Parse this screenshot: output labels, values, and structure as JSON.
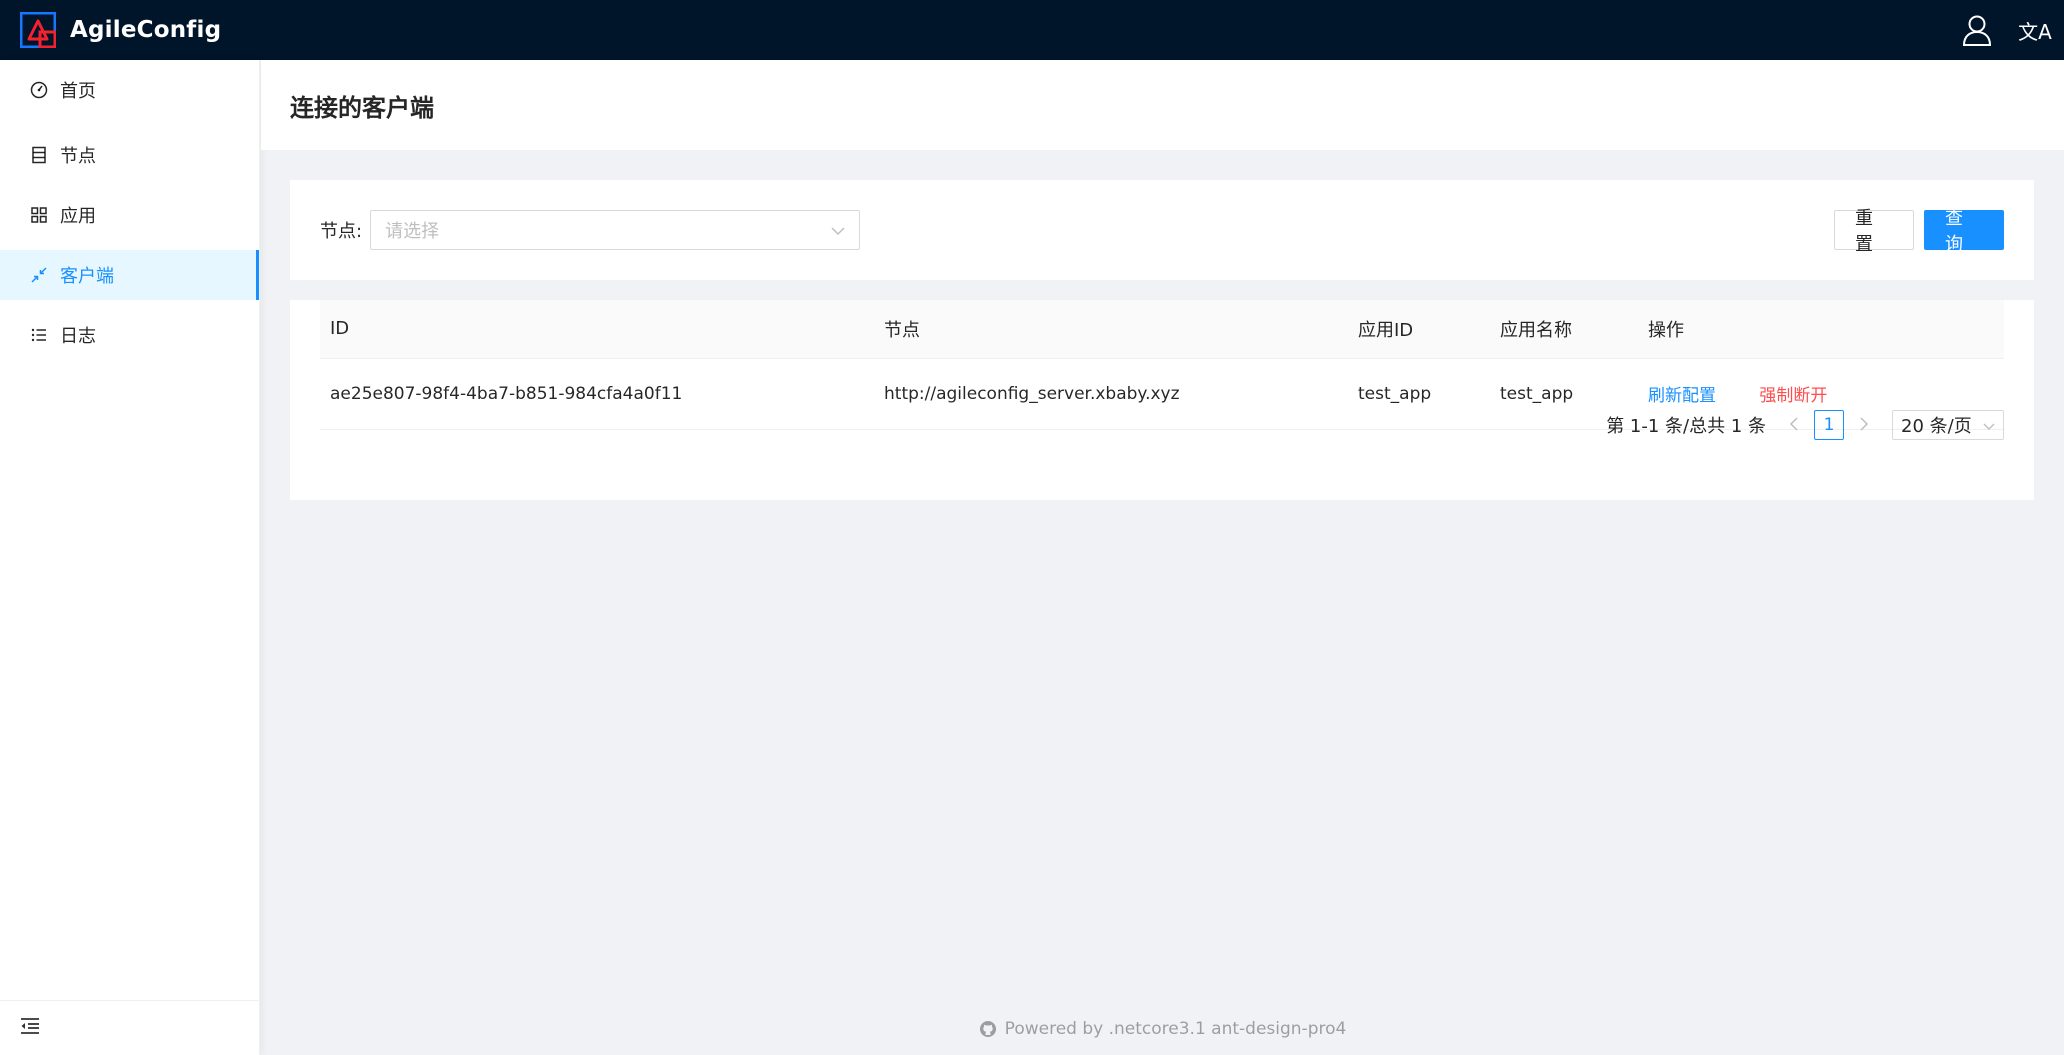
{
  "app": {
    "title": "AgileConfig"
  },
  "header": {
    "user_icon": "user-icon",
    "lang_icon": "translation-icon",
    "lang_glyph": "文A"
  },
  "sidebar": {
    "items": [
      {
        "label": "首页",
        "icon": "dashboard-icon",
        "active": false
      },
      {
        "label": "节点",
        "icon": "database-icon",
        "active": false
      },
      {
        "label": "应用",
        "icon": "appstore-icon",
        "active": false
      },
      {
        "label": "客户端",
        "icon": "shrink-icon",
        "active": true
      },
      {
        "label": "日志",
        "icon": "unordered-list-icon",
        "active": false
      }
    ],
    "collapse_icon": "menu-fold-icon"
  },
  "page": {
    "title": "连接的客户端"
  },
  "search": {
    "node_label": "节点:",
    "node_placeholder": "请选择",
    "reset_label": "重 置",
    "query_label": "查 询"
  },
  "table": {
    "columns": [
      "ID",
      "节点",
      "应用ID",
      "应用名称",
      "操作"
    ],
    "rows": [
      {
        "id": "ae25e807-98f4-4ba7-b851-984cfa4a0f11",
        "node": "http://agileconfig_server.xbaby.xyz",
        "app_id": "test_app",
        "app_name": "test_app",
        "action_refresh": "刷新配置",
        "action_disconnect": "强制断开"
      }
    ]
  },
  "pagination": {
    "total_text": "第 1-1 条/总共 1 条",
    "current_page": "1",
    "page_size": "20 条/页"
  },
  "footer": {
    "text": "Powered by .netcore3.1 ant-design-pro4"
  },
  "colors": {
    "primary": "#1890ff",
    "danger": "#ff4d4f",
    "header_bg": "#001529"
  }
}
